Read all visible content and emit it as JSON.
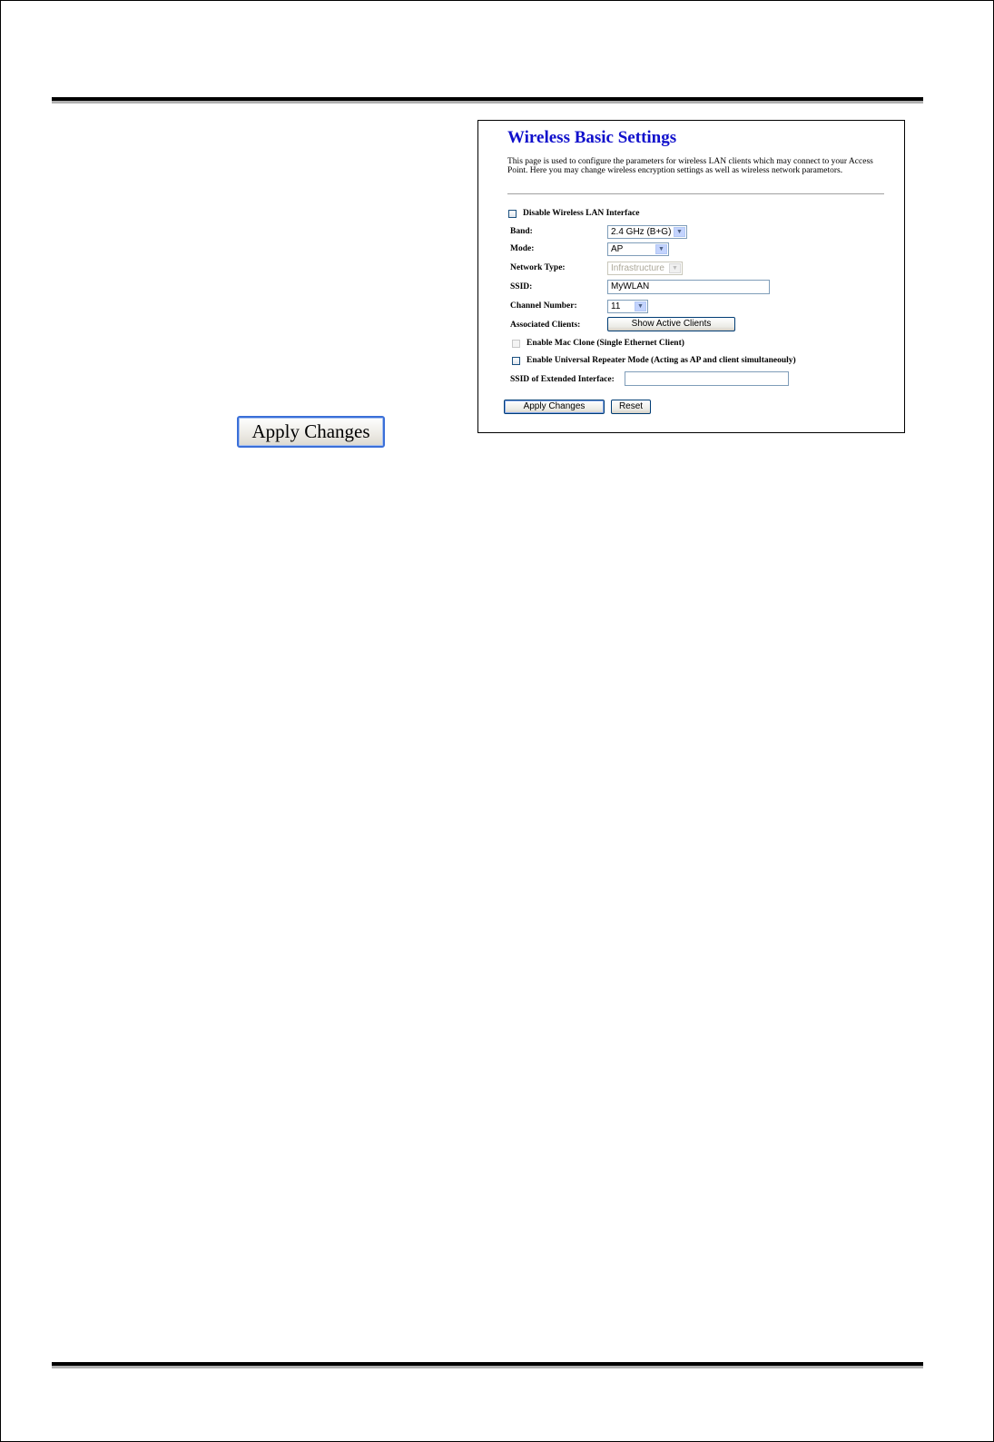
{
  "apply_button_label": "Apply Changes",
  "panel": {
    "title": "Wireless Basic Settings",
    "description": "This page is used to configure the parameters for wireless LAN clients which may connect to your Access Point. Here you may change wireless encryption settings as well as wireless network parametors.",
    "disable_wlan_label": "Disable Wireless LAN Interface",
    "band": {
      "label": "Band:",
      "value": "2.4 GHz (B+G)"
    },
    "mode": {
      "label": "Mode:",
      "value": "AP"
    },
    "network_type": {
      "label": "Network Type:",
      "value": "Infrastructure"
    },
    "ssid": {
      "label": "SSID:",
      "value": "MyWLAN"
    },
    "channel": {
      "label": "Channel Number:",
      "value": "11"
    },
    "associated_clients": {
      "label": "Associated Clients:",
      "button": "Show Active Clients"
    },
    "mac_clone_label": "Enable Mac Clone (Single Ethernet Client)",
    "repeater_label": "Enable Universal Repeater Mode (Acting as AP and client simultaneouly)",
    "extended_ssid": {
      "label": "SSID of Extended Interface:",
      "value": ""
    },
    "apply_label": "Apply Changes",
    "reset_label": "Reset"
  },
  "colors": {
    "title": "#1010cc",
    "button_border": "#003c74",
    "field_border": "#7f9db9"
  }
}
